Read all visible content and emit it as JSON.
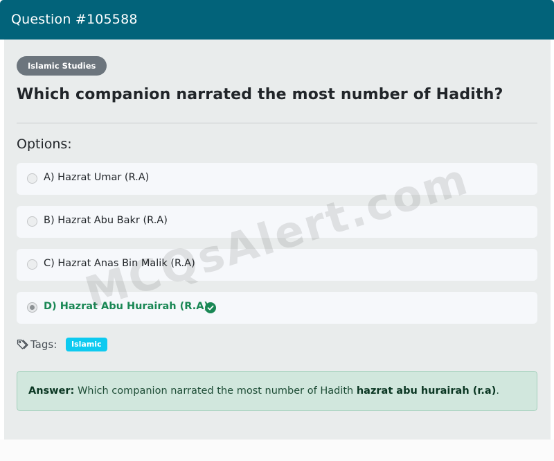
{
  "header": {
    "title": "Question #105588"
  },
  "category": "Islamic Studies",
  "question": "Which companion narrated the most number of Hadith?",
  "options_label": "Options:",
  "options": [
    {
      "text": "A) Hazrat Umar (R.A)",
      "selected": false,
      "correct": false
    },
    {
      "text": "B) Hazrat Abu Bakr (R.A)",
      "selected": false,
      "correct": false
    },
    {
      "text": "C) Hazrat Anas Bin Malik (R.A)",
      "selected": false,
      "correct": false
    },
    {
      "text": "D) Hazrat Abu Hurairah (R.A)",
      "selected": true,
      "correct": true
    }
  ],
  "tags": {
    "label": "Tags:",
    "items": [
      "Islamic"
    ]
  },
  "answer": {
    "label": "Answer:",
    "text": "Which companion narrated the most number of Hadith",
    "value": "hazrat abu hurairah (r.a)",
    "suffix": "."
  },
  "watermark": "MCQsAlert.com",
  "colors": {
    "header": "#02637a",
    "correct": "#198754",
    "tag": "#0dcaf0",
    "category": "#6c757d",
    "answer_bg": "#d1e7dd"
  },
  "icons": {
    "tags": "tags-icon",
    "correct": "check-circle-icon"
  }
}
